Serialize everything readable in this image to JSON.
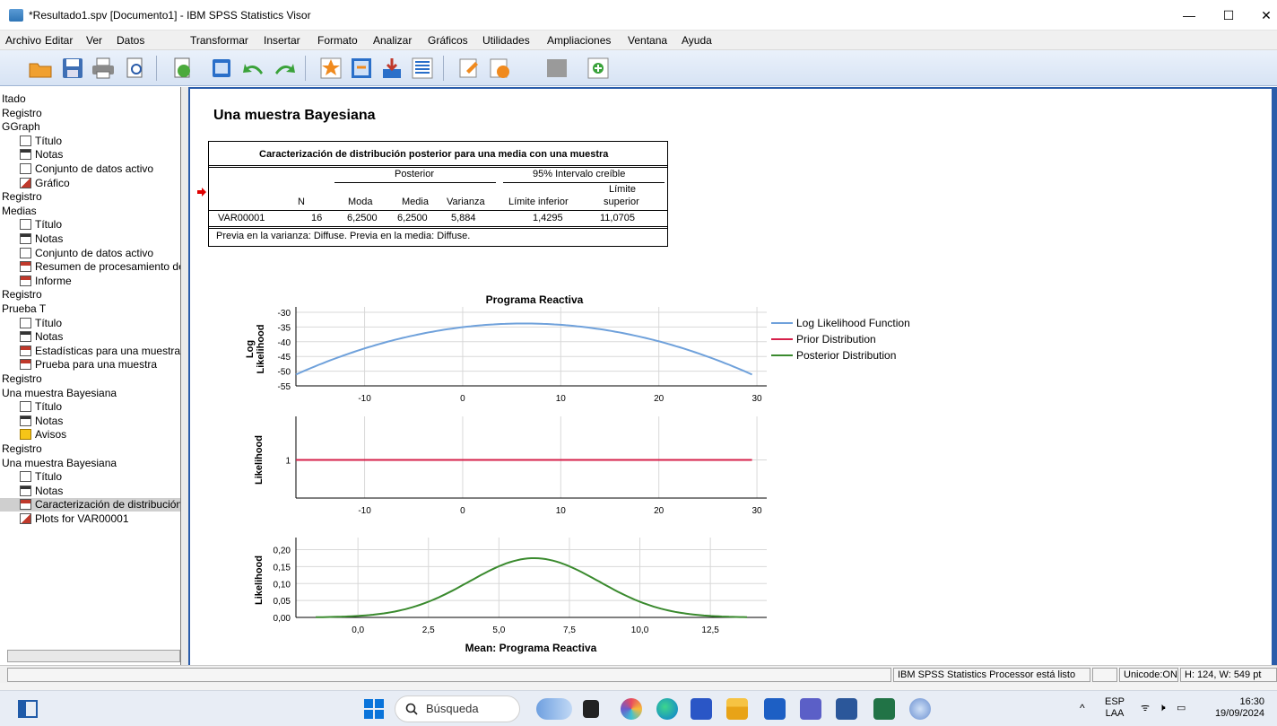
{
  "window": {
    "title": "*Resultado1.spv [Documento1] - IBM SPSS Statistics Visor",
    "controls": [
      "—",
      "☐",
      "✕"
    ]
  },
  "menu": [
    "Archivo",
    "Editar",
    "Ver",
    "Datos",
    "Transformar",
    "Insertar",
    "Formato",
    "Analizar",
    "Gráficos",
    "Utilidades",
    "Ampliaciones",
    "Ventana",
    "Ayuda"
  ],
  "toolbar_icons": [
    "open-folder-icon",
    "save-icon",
    "print-icon",
    "print-preview-icon",
    "export-icon",
    "recall-dialog-icon",
    "undo-icon",
    "redo-icon",
    "goto-data-icon",
    "goto-case-icon",
    "insert-variable-icon",
    "variables-icon",
    "designate-window-icon",
    "show-output-icon",
    "hide-output-icon",
    "insert-output-icon"
  ],
  "navigator": {
    "items": [
      {
        "label": "Itado",
        "icon": ""
      },
      {
        "label": "Registro",
        "icon": ""
      },
      {
        "label": "GGraph",
        "icon": ""
      },
      {
        "label": "Título",
        "icon": "title-icon",
        "indent": true
      },
      {
        "label": "Notas",
        "icon": "notes-icon",
        "indent": true
      },
      {
        "label": "Conjunto de datos activo",
        "icon": "dataset-icon",
        "indent": true
      },
      {
        "label": "Gráfico",
        "icon": "chart-icon",
        "indent": true
      },
      {
        "label": "Registro",
        "icon": ""
      },
      {
        "label": "Medias",
        "icon": ""
      },
      {
        "label": "Título",
        "icon": "title-icon",
        "indent": true
      },
      {
        "label": "Notas",
        "icon": "notes-icon",
        "indent": true
      },
      {
        "label": "Conjunto de datos activo",
        "icon": "dataset-icon",
        "indent": true
      },
      {
        "label": "Resumen de procesamiento de",
        "icon": "table-icon",
        "indent": true
      },
      {
        "label": "Informe",
        "icon": "table-icon",
        "indent": true
      },
      {
        "label": "Registro",
        "icon": ""
      },
      {
        "label": "Prueba T",
        "icon": ""
      },
      {
        "label": "Título",
        "icon": "title-icon",
        "indent": true
      },
      {
        "label": "Notas",
        "icon": "notes-icon",
        "indent": true
      },
      {
        "label": "Estadísticas para una muestra",
        "icon": "table-icon",
        "indent": true
      },
      {
        "label": "Prueba para una muestra",
        "icon": "table-icon",
        "indent": true
      },
      {
        "label": "Registro",
        "icon": ""
      },
      {
        "label": "Una muestra Bayesiana",
        "icon": ""
      },
      {
        "label": "Título",
        "icon": "title-icon",
        "indent": true
      },
      {
        "label": "Notas",
        "icon": "notes-icon",
        "indent": true
      },
      {
        "label": "Avisos",
        "icon": "warning-icon",
        "indent": true
      },
      {
        "label": "Registro",
        "icon": ""
      },
      {
        "label": "Una muestra Bayesiana",
        "icon": ""
      },
      {
        "label": "Título",
        "icon": "title-icon",
        "indent": true
      },
      {
        "label": "Notas",
        "icon": "notes-icon",
        "indent": true
      },
      {
        "label": "Caracterización de distribución",
        "icon": "table-icon",
        "indent": true,
        "selected": true
      },
      {
        "label": "Plots for VAR00001",
        "icon": "chart-icon",
        "indent": true
      }
    ]
  },
  "output": {
    "heading": "Una muestra Bayesiana",
    "table": {
      "title": "Caracterización de distribución posterior para una media con una muestra",
      "group_posterior": "Posterior",
      "group_interval": "95% Intervalo creíble",
      "col_n": "N",
      "col_moda": "Moda",
      "col_media": "Media",
      "col_varianza": "Varianza",
      "col_lower": "Límite inferior",
      "col_upper_1": "Límite",
      "col_upper_2": "superior",
      "row_label": "VAR00001",
      "row_n": "16",
      "row_moda": "6,2500",
      "row_media": "6,2500",
      "row_varianza": "5,884",
      "row_lower": "1,4295",
      "row_upper": "11,0705",
      "footnote": "Previa en la varianza: Diffuse. Previa en la media: Diffuse."
    }
  },
  "chart_data": [
    {
      "type": "line",
      "title": "Programa Reactiva",
      "ylabel_1": "Log",
      "ylabel_2": "Likelihood",
      "xlim": [
        -17,
        31
      ],
      "ylim": [
        -55,
        -30
      ],
      "xticks": [
        "-10",
        "0",
        "10",
        "20",
        "30"
      ],
      "yticks": [
        "-30",
        "-35",
        "-40",
        "-45",
        "-50",
        "-55"
      ],
      "series": [
        {
          "name": "Log Likelihood Function",
          "color": "#6fa1db",
          "center": 6.25,
          "peak": -33.8,
          "endpoint_left": -51.5,
          "endpoint_right": -51.5,
          "x_range": [
            -17,
            29.5
          ]
        }
      ],
      "legend": [
        {
          "name": "Log Likelihood Function",
          "color": "#6fa1db"
        },
        {
          "name": "Prior Distribution",
          "color": "#d6204a"
        },
        {
          "name": "Posterior Distribution",
          "color": "#3a8a2e"
        }
      ],
      "legend_position": "right",
      "grid": true
    },
    {
      "type": "line",
      "ylabel": "Likelihood",
      "xlim": [
        -17,
        31
      ],
      "ylim": [
        0,
        2
      ],
      "xticks": [
        "-10",
        "0",
        "10",
        "20",
        "30"
      ],
      "yticks": [
        "1"
      ],
      "series": [
        {
          "name": "Prior Distribution",
          "color": "#d6204a",
          "constant": 1,
          "x_range": [
            -17,
            29.5
          ]
        }
      ],
      "grid": true
    },
    {
      "type": "line",
      "ylabel": "Likelihood",
      "xlabel": "Mean: Programa Reactiva",
      "xlim": [
        -2.2,
        14.5
      ],
      "ylim": [
        0,
        0.22
      ],
      "xticks": [
        "0,0",
        "2,5",
        "5,0",
        "7,5",
        "10,0",
        "12,5"
      ],
      "yticks": [
        "0,20",
        "0,15",
        "0,10",
        "0,05",
        "0,00"
      ],
      "series": [
        {
          "name": "Posterior Distribution",
          "color": "#3a8a2e",
          "center": 6.25,
          "peak": 0.175,
          "sd": 2.3,
          "x_range": [
            -1.5,
            13.8
          ]
        }
      ],
      "grid": true
    }
  ],
  "status": {
    "processor": "IBM SPSS Statistics Processor está listo",
    "unicode": "Unicode:ON",
    "dims": "H: 124, W: 549 pt"
  },
  "taskbar": {
    "search": "Búsqueda",
    "lang_1": "ESP",
    "lang_2": "LAA",
    "time": "16:30",
    "date": "19/09/2024"
  }
}
